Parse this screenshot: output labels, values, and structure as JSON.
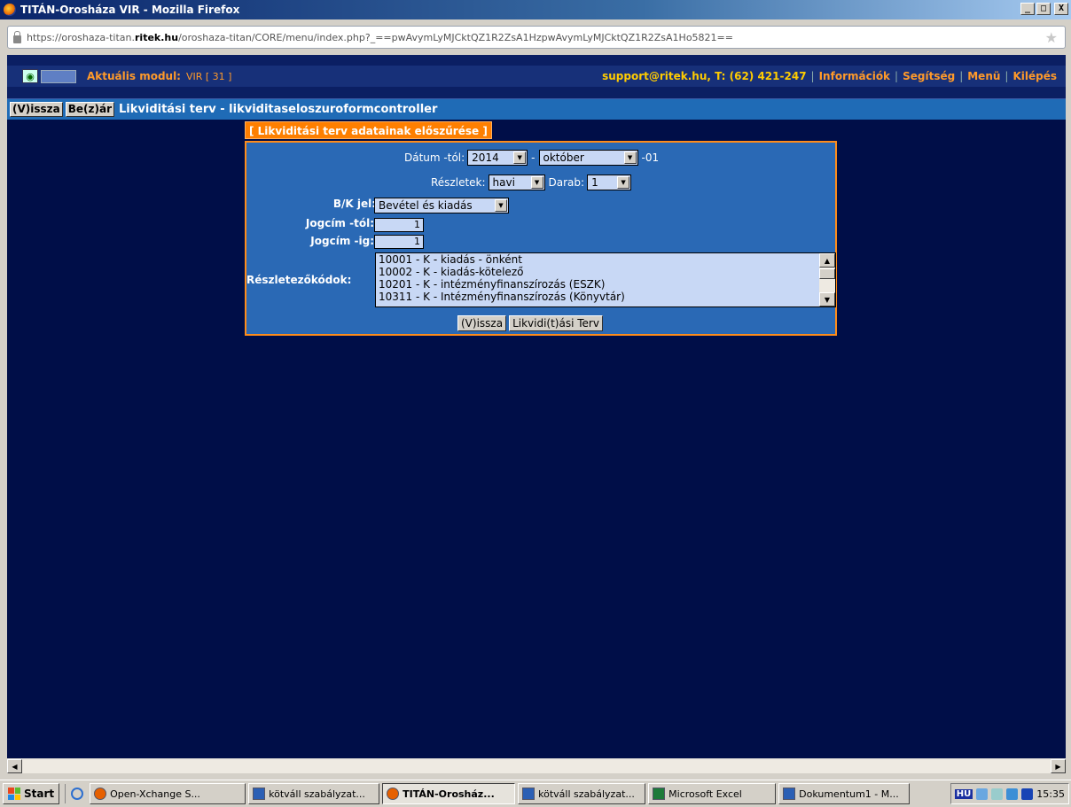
{
  "window": {
    "title": "TITÁN-Orosháza VIR - Mozilla Firefox",
    "min_label": "_",
    "max_label": "□",
    "close_label": "X"
  },
  "browser": {
    "url_prefix": "https://oroshaza-titan.",
    "url_domain": "ritek.hu",
    "url_suffix": "/oroshaza-titan/CORE/menu/index.php?_==pwAvymLyMJCktQZ1R2ZsA1HzpwAvymLyMJCktQZ1R2ZsA1Ho5821=="
  },
  "app_header": {
    "module_label": "Aktuális modul:",
    "module_value": "VIR [ 31 ]",
    "support": "support@ritek.hu, T: (62) 421-247",
    "links": [
      "Információk",
      "Segítség",
      "Menü",
      "Kilépés"
    ],
    "separator": "|"
  },
  "toolbar": {
    "back_button": "(V)issza",
    "close_button": "Be(z)ár",
    "title": "Likviditási terv - likviditaseloszuroformcontroller"
  },
  "dialog": {
    "tab_title": "[ Likviditási terv adatainak előszűrése ]",
    "date_label": "Dátum -tól:",
    "year": "2014",
    "month": "október",
    "day_suffix": "-01",
    "dash": "-",
    "details_label": "Részletek:",
    "details_value": "havi",
    "count_label": "Darab:",
    "count_value": "1",
    "bk_label": "B/K jel:",
    "bk_value": "Bevétel és kiadás",
    "jogcim_from_label": "Jogcím -tól:",
    "jogcim_from_value": "1",
    "jogcim_to_label": "Jogcím -ig:",
    "jogcim_to_value": "1",
    "codes_label": "Részletezőkódok:",
    "codes": [
      "10001 - K - kiadás - önként",
      "10002 - K - kiadás-kötelező",
      "10201 - K - intézményfinanszírozás (ESZK)",
      "10311 - K - Intézményfinanszírozás (Könyvtár)"
    ],
    "back_button": "(V)issza",
    "submit_button": "Likvidi(t)ási Terv"
  },
  "taskbar": {
    "start": "Start",
    "tasks": [
      {
        "label": "Open-Xchange S...",
        "icon": "firefox-icon",
        "active": false
      },
      {
        "label": "kötváll szabályzat...",
        "icon": "word-icon",
        "active": false
      },
      {
        "label": "TITÁN-Orosház...",
        "icon": "firefox-icon",
        "active": true
      },
      {
        "label": "kötváll szabályzat...",
        "icon": "word-icon",
        "active": false
      },
      {
        "label": "Microsoft Excel",
        "icon": "excel-icon",
        "active": false
      },
      {
        "label": "Dokumentum1 - M...",
        "icon": "word-icon",
        "active": false
      }
    ],
    "lang": "HU",
    "clock": "15:35"
  },
  "colors": {
    "page_bg": "#000e48",
    "accent_orange": "#ff7f00",
    "dialog_bg": "#2a69b5",
    "toolbar_bg": "#1f6bb6"
  }
}
